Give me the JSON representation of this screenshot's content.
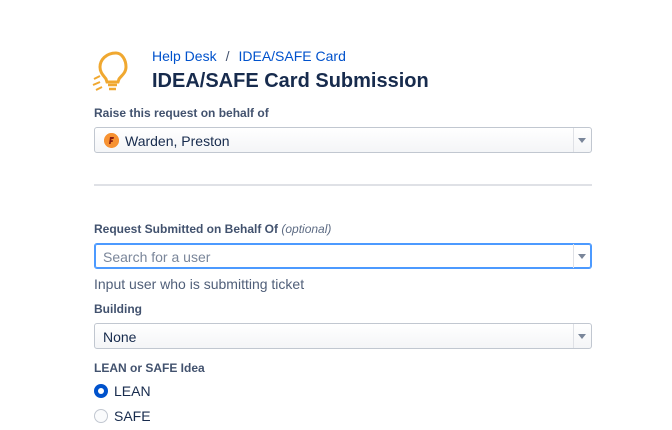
{
  "breadcrumb": {
    "items": [
      "Help Desk",
      "IDEA/SAFE Card"
    ],
    "separator": "/"
  },
  "page_title": "IDEA/SAFE Card Submission",
  "icons": {
    "logo": "lightbulb-icon",
    "avatar": "user-avatar-icon",
    "dropdown": "chevron-down-icon"
  },
  "colors": {
    "link": "#0052cc",
    "logo": "#f0a830",
    "avatar": "#f79232",
    "radio_checked": "#0052cc",
    "focus": "#4c9aff"
  },
  "fields": {
    "on_behalf": {
      "label": "Raise this request on behalf of",
      "value": "Warden, Preston"
    },
    "submitted_by": {
      "label": "Request Submitted on Behalf Of",
      "optional": "(optional)",
      "placeholder": "Search for a user",
      "help": "Input user who is submitting ticket"
    },
    "building": {
      "label": "Building",
      "value": "None"
    },
    "idea_type": {
      "label": "LEAN or SAFE Idea",
      "options": [
        {
          "label": "LEAN",
          "checked": true
        },
        {
          "label": "SAFE",
          "checked": false
        }
      ]
    }
  }
}
